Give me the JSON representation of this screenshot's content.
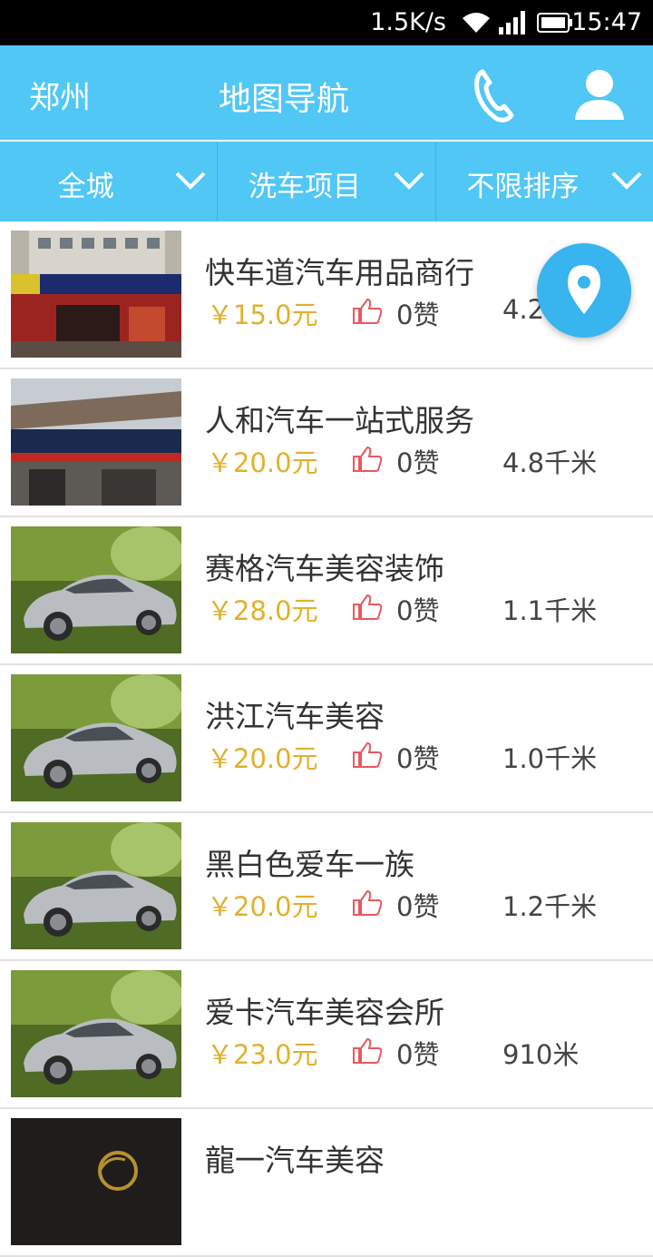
{
  "status_bar": {
    "network_speed": "1.5K/s",
    "time": "15:47"
  },
  "header": {
    "city": "郑州",
    "title": "地图导航",
    "phone_icon": "phone-icon",
    "user_icon": "user-icon"
  },
  "filters": [
    {
      "label": "全城"
    },
    {
      "label": "洗车项目"
    },
    {
      "label": "不限排序"
    }
  ],
  "colors": {
    "header_bg": "#51c7f5",
    "price": "#e0b12e",
    "like_icon": "#e8595e",
    "fab": "#38b4ef"
  },
  "shops": [
    {
      "name": "快车道汽车用品商行",
      "price": "￥15.0元",
      "likes": "0赞",
      "distance": "4.2",
      "thumb": "storefront"
    },
    {
      "name": "人和汽车一站式服务",
      "price": "￥20.0元",
      "likes": "0赞",
      "distance": "4.8千米",
      "thumb": "storefront"
    },
    {
      "name": "赛格汽车美容装饰",
      "price": "￥28.0元",
      "likes": "0赞",
      "distance": "1.1千米",
      "thumb": "car"
    },
    {
      "name": "洪江汽车美容",
      "price": "￥20.0元",
      "likes": "0赞",
      "distance": "1.0千米",
      "thumb": "car"
    },
    {
      "name": "黑白色爱车一族",
      "price": "￥20.0元",
      "likes": "0赞",
      "distance": "1.2千米",
      "thumb": "car"
    },
    {
      "name": "爱卡汽车美容会所",
      "price": "￥23.0元",
      "likes": "0赞",
      "distance": "910米",
      "thumb": "car"
    },
    {
      "name": "龍一汽车美容",
      "price": "",
      "likes": "",
      "distance": "",
      "thumb": "logo"
    }
  ]
}
